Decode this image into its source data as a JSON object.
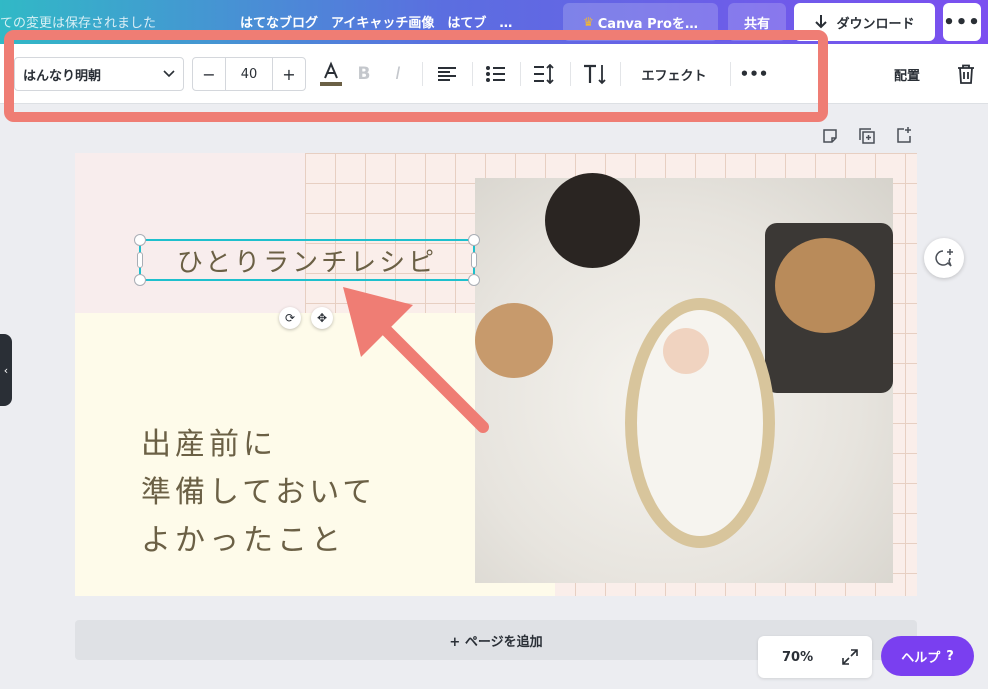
{
  "topbar": {
    "save_status": "ての変更は保存されました",
    "doc_title": "はてなブログ　アイキャッチ画像　はてブ　…",
    "pro_label": "Canva Proを…",
    "share_label": "共有",
    "download_label": "ダウンロード",
    "more_label": "•••"
  },
  "toolbar": {
    "font_name": "はんなり明朝",
    "font_size": "40",
    "decrease": "−",
    "increase": "+",
    "effects_label": "エフェクト",
    "more_label": "•••",
    "arrange_label": "配置"
  },
  "canvas": {
    "title_text": "ひとりランチレシピ",
    "subtitle_lines": [
      "出産前に",
      "準備しておいて",
      "よかったこと"
    ]
  },
  "footer": {
    "add_page_label": "+ ページを追加",
    "zoom_label": "70%",
    "help_label": "ヘルプ",
    "help_icon_text": "?"
  },
  "colors": {
    "brand_gradient_start": "#31b9c6",
    "brand_gradient_end": "#7b4ff0",
    "highlight": "#ef7d74",
    "selection": "#1ec0cd",
    "help_button": "#7a3ff0",
    "text_brown": "#6b6045"
  }
}
